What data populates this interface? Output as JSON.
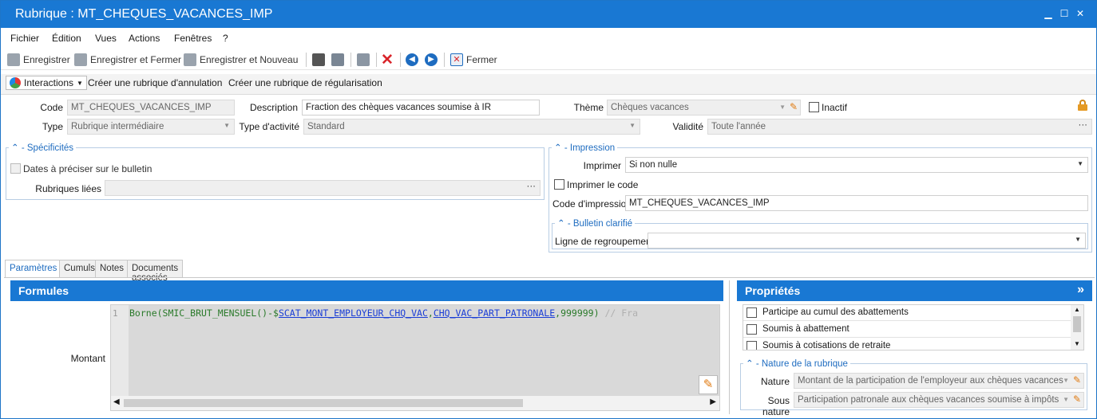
{
  "window": {
    "title": "Rubrique : MT_CHEQUES_VACANCES_IMP",
    "min": "▁",
    "max": "☐",
    "close": "✕"
  },
  "menu": [
    "Fichier",
    "Édition",
    "Vues",
    "Actions",
    "Fenêtres",
    "?"
  ],
  "toolbar": {
    "save": "Enregistrer",
    "save_close": "Enregistrer et Fermer",
    "save_new": "Enregistrer et Nouveau",
    "close": "Fermer"
  },
  "actions": {
    "interactions": "Interactions",
    "create_cancel": "Créer une rubrique d'annulation",
    "create_regul": "Créer une rubrique de régularisation"
  },
  "form": {
    "code_label": "Code",
    "code_value": "MT_CHEQUES_VACANCES_IMP",
    "desc_label": "Description",
    "desc_value": "Fraction des chèques vacances soumise à IR",
    "theme_label": "Thème",
    "theme_value": "Chèques vacances",
    "inactif_label": "Inactif",
    "type_label": "Type",
    "type_value": "Rubrique intermédiaire",
    "activity_label": "Type d'activité",
    "activity_value": "Standard",
    "validity_label": "Validité",
    "validity_value": "Toute l'année",
    "ellipsis": "···"
  },
  "specificites": {
    "title": "Spécificités",
    "dates_label": "Dates à préciser sur le bulletin",
    "rubriques_label": "Rubriques liées"
  },
  "impression": {
    "title": "Impression",
    "imprimer_label": "Imprimer",
    "imprimer_value": "Si non nulle",
    "print_code_label": "Imprimer le code",
    "code_label": "Code d'impression",
    "code_value": "MT_CHEQUES_VACANCES_IMP",
    "bulletin_title": "Bulletin clarifié",
    "ligne_label": "Ligne de regroupement",
    "ligne_value": ""
  },
  "tabs": [
    "Paramètres",
    "Cumuls",
    "Notes",
    "Documents associés"
  ],
  "formules": {
    "title": "Formules",
    "montant_label": "Montant",
    "line_no": "1",
    "code_plain1": "Borne(SMIC_BRUT_MENSUEL()-$",
    "code_link1": "SCAT_MONT_EMPLOYEUR_CHQ_VAC",
    "code_sep": ",",
    "code_link2": "CHQ_VAC_PART_PATRONALE",
    "code_plain2": ",999999)",
    "code_comment": "// Fra"
  },
  "proprietes": {
    "title": "Propriétés",
    "expand": "»",
    "items": [
      "Participe au cumul des abattements",
      "Soumis à abattement",
      "Soumis à cotisations de retraite"
    ],
    "nature_title": "Nature de la rubrique",
    "nature_label": "Nature",
    "nature_value": "Montant de la participation de l'employeur aux chèques vacances",
    "sous_nature_label": "Sous nature",
    "sous_nature_value": "Participation patronale aux chèques vacances soumise à impôts"
  },
  "colors": {
    "accent": "#1978d3",
    "group_title": "#1e6cc0"
  }
}
